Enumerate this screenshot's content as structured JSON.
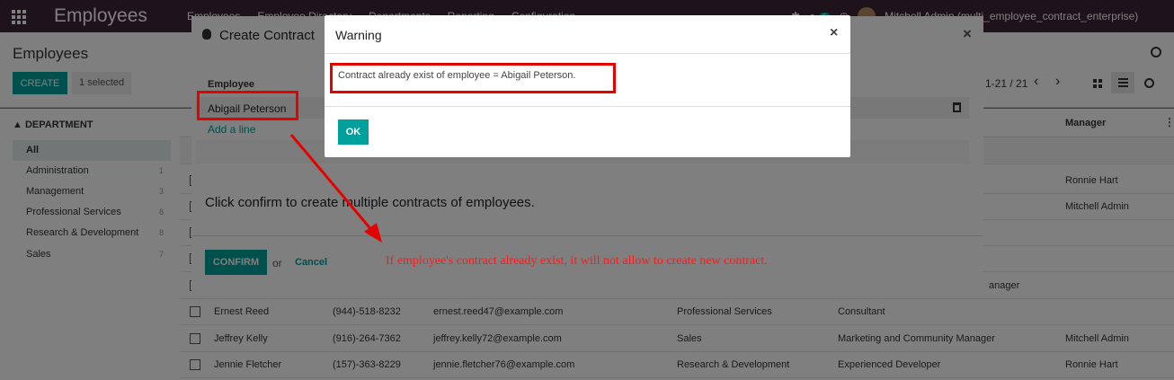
{
  "topbar": {
    "app_title": "Employees",
    "menu": [
      "Employees",
      "Employee Directory",
      "Departments",
      "Reporting",
      "Configuration"
    ],
    "chat_count": "5",
    "user": "Mitchell Admin (multi_employee_contract_enterprise)"
  },
  "control_panel": {
    "breadcrumb": "Employees",
    "create_label": "CREATE",
    "selected_label": "1 selected",
    "pager": "1-21 / 21"
  },
  "sidebar": {
    "title": "DEPARTMENT",
    "items": [
      {
        "label": "All",
        "count": ""
      },
      {
        "label": "Administration",
        "count": "1"
      },
      {
        "label": "Management",
        "count": "3"
      },
      {
        "label": "Professional Services",
        "count": "8"
      },
      {
        "label": "Research & Development",
        "count": "8"
      },
      {
        "label": "Sales",
        "count": "7"
      }
    ]
  },
  "list": {
    "manager_header": "Manager",
    "rows_partial": [
      {
        "manager": "Ronnie Hart"
      },
      {
        "manager": "Mitchell Admin"
      },
      {
        "job_tail": "anager"
      }
    ],
    "rows": [
      {
        "name": "Ernest Reed",
        "phone": "(944)-518-8232",
        "email": "ernest.reed47@example.com",
        "department": "Professional Services",
        "job": "Consultant",
        "manager": ""
      },
      {
        "name": "Jeffrey Kelly",
        "phone": "(916)-264-7362",
        "email": "jeffrey.kelly72@example.com",
        "department": "Sales",
        "job": "Marketing and Community Manager",
        "manager": "Mitchell Admin"
      },
      {
        "name": "Jennie Fletcher",
        "phone": "(157)-363-8229",
        "email": "jennie.fletcher76@example.com",
        "department": "Research & Development",
        "job": "Experienced Developer",
        "manager": "Ronnie Hart"
      }
    ]
  },
  "create_contract": {
    "title": "Create Contract",
    "column_employee": "Employee",
    "employees": [
      "Abigail Peterson"
    ],
    "add_line": "Add a line",
    "message": "Click confirm to create multiple contracts of employees.",
    "confirm_label": "CONFIRM",
    "or_label": "or",
    "cancel_label": "Cancel"
  },
  "warning": {
    "title": "Warning",
    "message": "Contract already exist of employee = Abigail Peterson.",
    "ok_label": "OK"
  },
  "annotation": {
    "text": "If employee's contract already exist, it will not allow to create new contract.",
    "color": "#e60000"
  },
  "colors": {
    "topbar": "#3c2537",
    "accent": "#00a09d"
  },
  "icons": [
    "apps-icon",
    "search-icon",
    "kanban-icon",
    "list-icon",
    "clock-icon",
    "bug-icon",
    "trash-icon",
    "close-icon"
  ]
}
